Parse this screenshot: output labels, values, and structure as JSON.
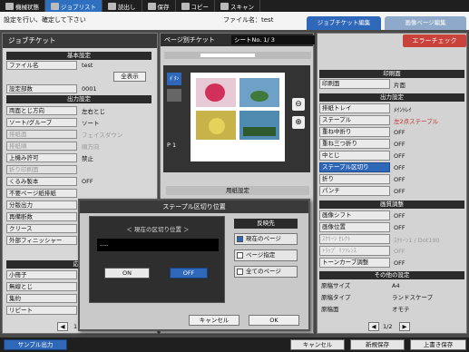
{
  "menu": [
    {
      "label": "機械状態",
      "icon": "machine-icon"
    },
    {
      "label": "ジョブリスト",
      "icon": "joblist-icon",
      "active": true
    },
    {
      "label": "読出し",
      "icon": "read-icon"
    },
    {
      "label": "保存",
      "icon": "save-icon"
    },
    {
      "label": "コピー",
      "icon": "copy-icon"
    },
    {
      "label": "スキャン",
      "icon": "scan-icon"
    }
  ],
  "header": {
    "message": "設定を行い、確定して下さい",
    "filename_label": "ファイル名：test",
    "tab_job_ticket_edit": "ジョブチケット編集",
    "tab_image_page_edit": "画像ページ編集"
  },
  "left_panel": {
    "title": "ジョブチケット",
    "sec_basic": "基本設定",
    "filename_label": "ファイル名",
    "filename_value": "test",
    "show_all": "全表示",
    "copies_label": "設定部数",
    "copies_value": "0001",
    "sec_output": "出力設定",
    "rows": [
      {
        "label": "両面とじ方向",
        "value": "左右とじ",
        "dis": false
      },
      {
        "label": "ソート/グループ",
        "value": "ソート",
        "dis": false
      },
      {
        "label": "排紙面",
        "value": "フェイスダウン",
        "dis": true
      },
      {
        "label": "排紙順",
        "value": "順方向",
        "dis": true
      },
      {
        "label": "上機み許可",
        "value": "禁止",
        "dis": false
      },
      {
        "label": "折り印刷面",
        "value": "",
        "dis": true
      },
      {
        "label": "くるみ製本",
        "value": "OFF",
        "dis": false
      },
      {
        "label": "不要ページ紙排紙",
        "value": "",
        "dis": false
      },
      {
        "label": "分版出力",
        "value": "",
        "dis": false
      },
      {
        "label": "再備断数",
        "value": "",
        "dis": false
      },
      {
        "label": "クリース",
        "value": "",
        "dis": false
      },
      {
        "label": "外部フィニッシャー",
        "value": "",
        "dis": false
      }
    ],
    "sec_apply": "応用",
    "apply_rows": [
      "小冊子",
      "無線とじ",
      "集約",
      "リピート"
    ],
    "page_num": "1"
  },
  "center": {
    "title": "ページ別チケット",
    "sheet_no": "シートNo.      1/      3",
    "thumb_tab": "ﾎﾞﾀﾝ",
    "page_label": "P    1",
    "paper_setting": "用紙設定"
  },
  "right_panel": {
    "error_check": "エラーチェック",
    "sec_print_side": "印刷面",
    "print_side_label": "印刷面",
    "print_side_value": "片面",
    "sec_output": "出力設定",
    "rows": [
      {
        "label": "排紙トレイ",
        "value": "ﾒｲﾝﾄﾚｲ",
        "style": ""
      },
      {
        "label": "ステープル",
        "value": "左2点ステープル",
        "style": "red"
      },
      {
        "label": "重ね中折り",
        "value": "OFF",
        "style": ""
      },
      {
        "label": "重ね三つ折り",
        "value": "OFF",
        "style": ""
      },
      {
        "label": "中とじ",
        "value": "OFF",
        "style": ""
      },
      {
        "label": "ステープル区切り",
        "value": "OFF",
        "style": "sel"
      },
      {
        "label": "折り",
        "value": "OFF",
        "style": ""
      },
      {
        "label": "パンチ",
        "value": "OFF",
        "style": ""
      }
    ],
    "sec_image": "画質調整",
    "image_rows": [
      {
        "label": "画像シフト",
        "value": "OFF",
        "style": ""
      },
      {
        "label": "画像位置",
        "value": "OFF",
        "style": ""
      },
      {
        "label": "ｽｸﾘｰﾝ ｾﾚｸﾄ",
        "value": "ｽｸﾘｰﾝ1 / Dot190",
        "style": "dis"
      },
      {
        "label": "ﾄﾗｯﾌﾟ ﾘﾌｧﾚﾝｽ",
        "value": "OFF",
        "style": "dis"
      },
      {
        "label": "トーンカーブ調整",
        "value": "OFF",
        "style": ""
      }
    ],
    "sec_other": "その他の設定",
    "other_rows": [
      {
        "label": "原稿サイズ",
        "value": "A4"
      },
      {
        "label": "原稿タイプ",
        "value": "ランドスケープ"
      },
      {
        "label": "原稿面",
        "value": "オモテ"
      }
    ],
    "page_num": "1/2"
  },
  "dialog": {
    "title": "ステープル区切り位置",
    "current_label": "＜ 現在の区切り位置 ＞",
    "current_value": "----",
    "on_label": "ON",
    "off_label": "OFF",
    "target_title": "反映先",
    "opt_current": "現在のページ",
    "opt_page": "ページ指定",
    "opt_all": "全てのページ",
    "cancel": "キャンセル",
    "ok": "OK"
  },
  "footer": {
    "sample_output": "サンプル出力",
    "cancel": "キャンセル",
    "new_save": "新規保存",
    "overwrite": "上書き保存"
  }
}
